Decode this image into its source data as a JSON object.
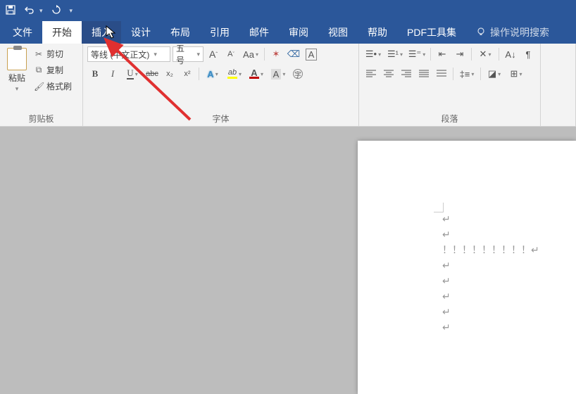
{
  "quickAccess": {
    "save": "💾",
    "undo": "↶",
    "redo": "↻",
    "more": "▾"
  },
  "tabs": {
    "file": "文件",
    "home": "开始",
    "insert": "插入",
    "design": "设计",
    "layout": "布局",
    "references": "引用",
    "mailings": "邮件",
    "review": "审阅",
    "view": "视图",
    "help": "帮助",
    "pdf": "PDF工具集",
    "tellme": "操作说明搜索"
  },
  "ribbon": {
    "clipboard": {
      "label": "剪贴板",
      "paste": "粘贴",
      "cut": "剪切",
      "copy": "复制",
      "formatPainter": "格式刷"
    },
    "font": {
      "label": "字体",
      "fontName": "等线 (中文正文)",
      "fontSize": "五号",
      "growA": "A",
      "shrinkA": "A",
      "caseAa": "Aa",
      "phonetic": "㑽",
      "charBorder": "A",
      "bold": "B",
      "italic": "I",
      "underline": "U",
      "strike": "abc",
      "sub": "x₂",
      "sup": "x²",
      "textEffect": "A",
      "highlight": "ab",
      "fontColor": "A",
      "charShade": "A",
      "enclose": "字"
    },
    "paragraph": {
      "label": "段落"
    }
  },
  "document": {
    "lines": [
      "↵",
      "↵",
      "！！！！！！！！！↵",
      "↵",
      "↵",
      "↵",
      "↵",
      "↵"
    ]
  },
  "colors": {
    "titlebar": "#2b579a",
    "highlight": "#ffff00",
    "fontcolor": "#c00000"
  }
}
